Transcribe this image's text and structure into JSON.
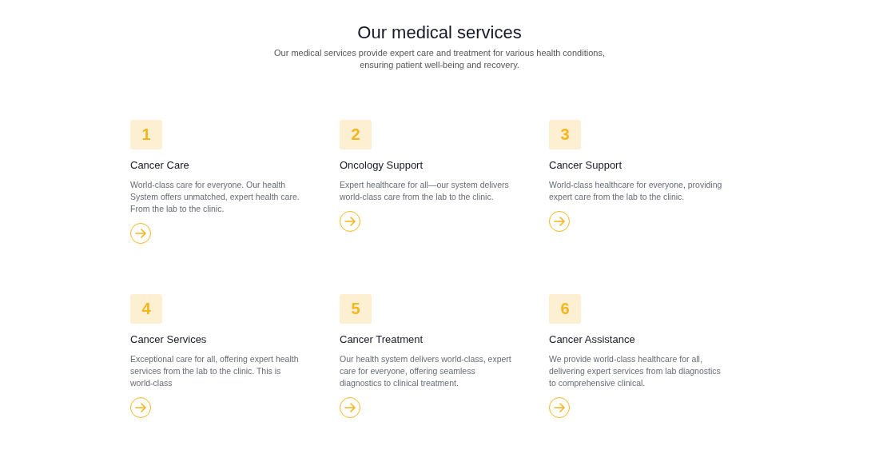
{
  "header": {
    "title": "Our medical services",
    "subtitle": "Our medical services provide expert care and treatment for various health conditions, ensuring patient well-being and recovery."
  },
  "services": [
    {
      "number": "1",
      "title": "Cancer Care",
      "description": "World-class care for everyone. Our health System offers unmatched, expert health care. From the lab to the clinic."
    },
    {
      "number": "2",
      "title": "Oncology Support",
      "description": "Expert healthcare for all—our system delivers world-class care from the lab to the clinic."
    },
    {
      "number": "3",
      "title": "Cancer Support",
      "description": "World-class healthcare for everyone, providing expert care from the lab to the clinic."
    },
    {
      "number": "4",
      "title": "Cancer Services",
      "description": "Exceptional care for all, offering expert health services from the lab to the clinic. This is world-class"
    },
    {
      "number": "5",
      "title": "Cancer Treatment",
      "description": "Our health system delivers world-class, expert care for everyone, offering seamless diagnostics to clinical treatment."
    },
    {
      "number": "6",
      "title": "Cancer Assistance",
      "description": "We provide world-class healthcare for all, delivering expert services from lab diagnostics to comprehensive clinical."
    }
  ]
}
